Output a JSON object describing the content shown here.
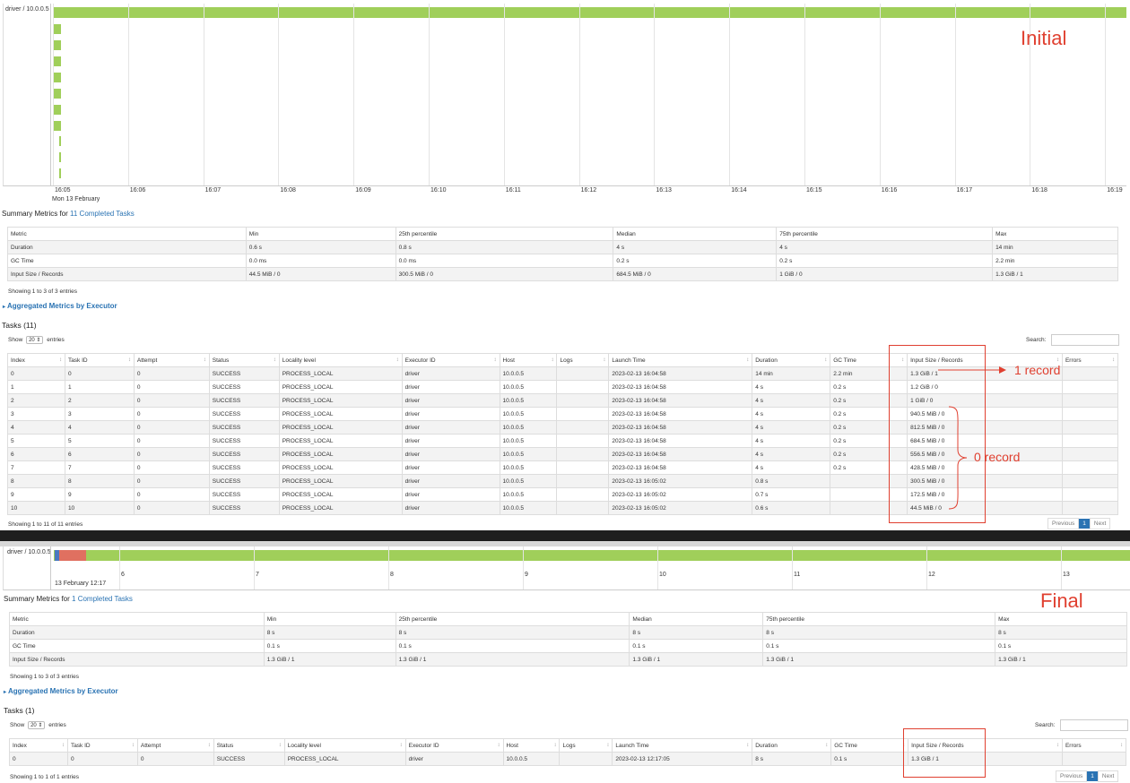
{
  "colors": {
    "accent": "#2a73b3",
    "bar_green": "#a0cf5a",
    "bar_red": "#e07060",
    "annotation": "#e04030"
  },
  "top": {
    "timeline": {
      "executor_label": "driver / 10.0.0.5",
      "ticks": [
        "16:05",
        "16:06",
        "16:07",
        "16:08",
        "16:09",
        "16:10",
        "16:11",
        "16:12",
        "16:13",
        "16:14",
        "16:15",
        "16:16",
        "16:17",
        "16:18",
        "16:19"
      ],
      "date_label": "Mon 13 February"
    },
    "annotation_initial": "Initial",
    "summary": {
      "prefix": "Summary Metrics for ",
      "link": "11 Completed Tasks",
      "headers": [
        "Metric",
        "Min",
        "25th percentile",
        "Median",
        "75th percentile",
        "Max"
      ],
      "rows": [
        [
          "Duration",
          "0.6 s",
          "0.8 s",
          "4 s",
          "4 s",
          "14 min"
        ],
        [
          "GC Time",
          "0.0 ms",
          "0.0 ms",
          "0.2 s",
          "0.2 s",
          "2.2 min"
        ],
        [
          "Input Size / Records",
          "44.5 MiB / 0",
          "300.5 MiB / 0",
          "684.5 MiB / 0",
          "1 GiB / 0",
          "1.3 GiB / 1"
        ]
      ],
      "showing": "Showing 1 to 3 of 3 entries"
    },
    "aggregated_link": "Aggregated Metrics by Executor",
    "tasks": {
      "title": "Tasks (11)",
      "show_label": "Show",
      "show_value": "20",
      "entries_label": "entries",
      "search_label": "Search:",
      "headers": [
        "Index",
        "Task ID",
        "Attempt",
        "Status",
        "Locality level",
        "Executor ID",
        "Host",
        "Logs",
        "Launch Time",
        "Duration",
        "GC Time",
        "Input Size / Records",
        "Errors"
      ],
      "rows": [
        [
          "0",
          "0",
          "0",
          "SUCCESS",
          "PROCESS_LOCAL",
          "driver",
          "10.0.0.5",
          "",
          "2023-02-13 16:04:58",
          "14 min",
          "2.2 min",
          "1.3 GiB / 1",
          ""
        ],
        [
          "1",
          "1",
          "0",
          "SUCCESS",
          "PROCESS_LOCAL",
          "driver",
          "10.0.0.5",
          "",
          "2023-02-13 16:04:58",
          "4 s",
          "0.2 s",
          "1.2 GiB / 0",
          ""
        ],
        [
          "2",
          "2",
          "0",
          "SUCCESS",
          "PROCESS_LOCAL",
          "driver",
          "10.0.0.5",
          "",
          "2023-02-13 16:04:58",
          "4 s",
          "0.2 s",
          "1 GiB / 0",
          ""
        ],
        [
          "3",
          "3",
          "0",
          "SUCCESS",
          "PROCESS_LOCAL",
          "driver",
          "10.0.0.5",
          "",
          "2023-02-13 16:04:58",
          "4 s",
          "0.2 s",
          "940.5 MiB / 0",
          ""
        ],
        [
          "4",
          "4",
          "0",
          "SUCCESS",
          "PROCESS_LOCAL",
          "driver",
          "10.0.0.5",
          "",
          "2023-02-13 16:04:58",
          "4 s",
          "0.2 s",
          "812.5 MiB / 0",
          ""
        ],
        [
          "5",
          "5",
          "0",
          "SUCCESS",
          "PROCESS_LOCAL",
          "driver",
          "10.0.0.5",
          "",
          "2023-02-13 16:04:58",
          "4 s",
          "0.2 s",
          "684.5 MiB / 0",
          ""
        ],
        [
          "6",
          "6",
          "0",
          "SUCCESS",
          "PROCESS_LOCAL",
          "driver",
          "10.0.0.5",
          "",
          "2023-02-13 16:04:58",
          "4 s",
          "0.2 s",
          "556.5 MiB / 0",
          ""
        ],
        [
          "7",
          "7",
          "0",
          "SUCCESS",
          "PROCESS_LOCAL",
          "driver",
          "10.0.0.5",
          "",
          "2023-02-13 16:04:58",
          "4 s",
          "0.2 s",
          "428.5 MiB / 0",
          ""
        ],
        [
          "8",
          "8",
          "0",
          "SUCCESS",
          "PROCESS_LOCAL",
          "driver",
          "10.0.0.5",
          "",
          "2023-02-13 16:05:02",
          "0.8 s",
          "",
          "300.5 MiB / 0",
          ""
        ],
        [
          "9",
          "9",
          "0",
          "SUCCESS",
          "PROCESS_LOCAL",
          "driver",
          "10.0.0.5",
          "",
          "2023-02-13 16:05:02",
          "0.7 s",
          "",
          "172.5 MiB / 0",
          ""
        ],
        [
          "10",
          "10",
          "0",
          "SUCCESS",
          "PROCESS_LOCAL",
          "driver",
          "10.0.0.5",
          "",
          "2023-02-13 16:05:02",
          "0.6 s",
          "",
          "44.5 MiB / 0",
          ""
        ]
      ],
      "showing": "Showing 1 to 11 of 11 entries",
      "previous": "Previous",
      "page": "1",
      "next": "Next"
    },
    "annotation_one": "1 record",
    "annotation_zero": "0 record"
  },
  "bottom": {
    "timeline": {
      "executor_label": "driver / 10.0.0.5",
      "ticks": [
        "6",
        "7",
        "8",
        "9",
        "10",
        "11",
        "12",
        "13"
      ],
      "date_label": "13 February 12:17"
    },
    "annotation_final": "Final",
    "summary": {
      "prefix": "Summary Metrics for ",
      "link": "1 Completed Tasks",
      "headers": [
        "Metric",
        "Min",
        "25th percentile",
        "Median",
        "75th percentile",
        "Max"
      ],
      "rows": [
        [
          "Duration",
          "8 s",
          "8 s",
          "8 s",
          "8 s",
          "8 s"
        ],
        [
          "GC Time",
          "0.1 s",
          "0.1 s",
          "0.1 s",
          "0.1 s",
          "0.1 s"
        ],
        [
          "Input Size / Records",
          "1.3 GiB / 1",
          "1.3 GiB / 1",
          "1.3 GiB / 1",
          "1.3 GiB / 1",
          "1.3 GiB / 1"
        ]
      ],
      "showing": "Showing 1 to 3 of 3 entries"
    },
    "aggregated_link": "Aggregated Metrics by Executor",
    "tasks": {
      "title": "Tasks (1)",
      "show_label": "Show",
      "show_value": "20",
      "entries_label": "entries",
      "search_label": "Search:",
      "headers": [
        "Index",
        "Task ID",
        "Attempt",
        "Status",
        "Locality level",
        "Executor ID",
        "Host",
        "Logs",
        "Launch Time",
        "Duration",
        "GC Time",
        "Input Size / Records",
        "Errors"
      ],
      "rows": [
        [
          "0",
          "0",
          "0",
          "SUCCESS",
          "PROCESS_LOCAL",
          "driver",
          "10.0.0.5",
          "",
          "2023-02-13 12:17:05",
          "8 s",
          "0.1 s",
          "1.3 GiB / 1",
          ""
        ]
      ],
      "showing": "Showing 1 to 1 of 1 entries",
      "previous": "Previous",
      "page": "1",
      "next": "Next"
    }
  }
}
